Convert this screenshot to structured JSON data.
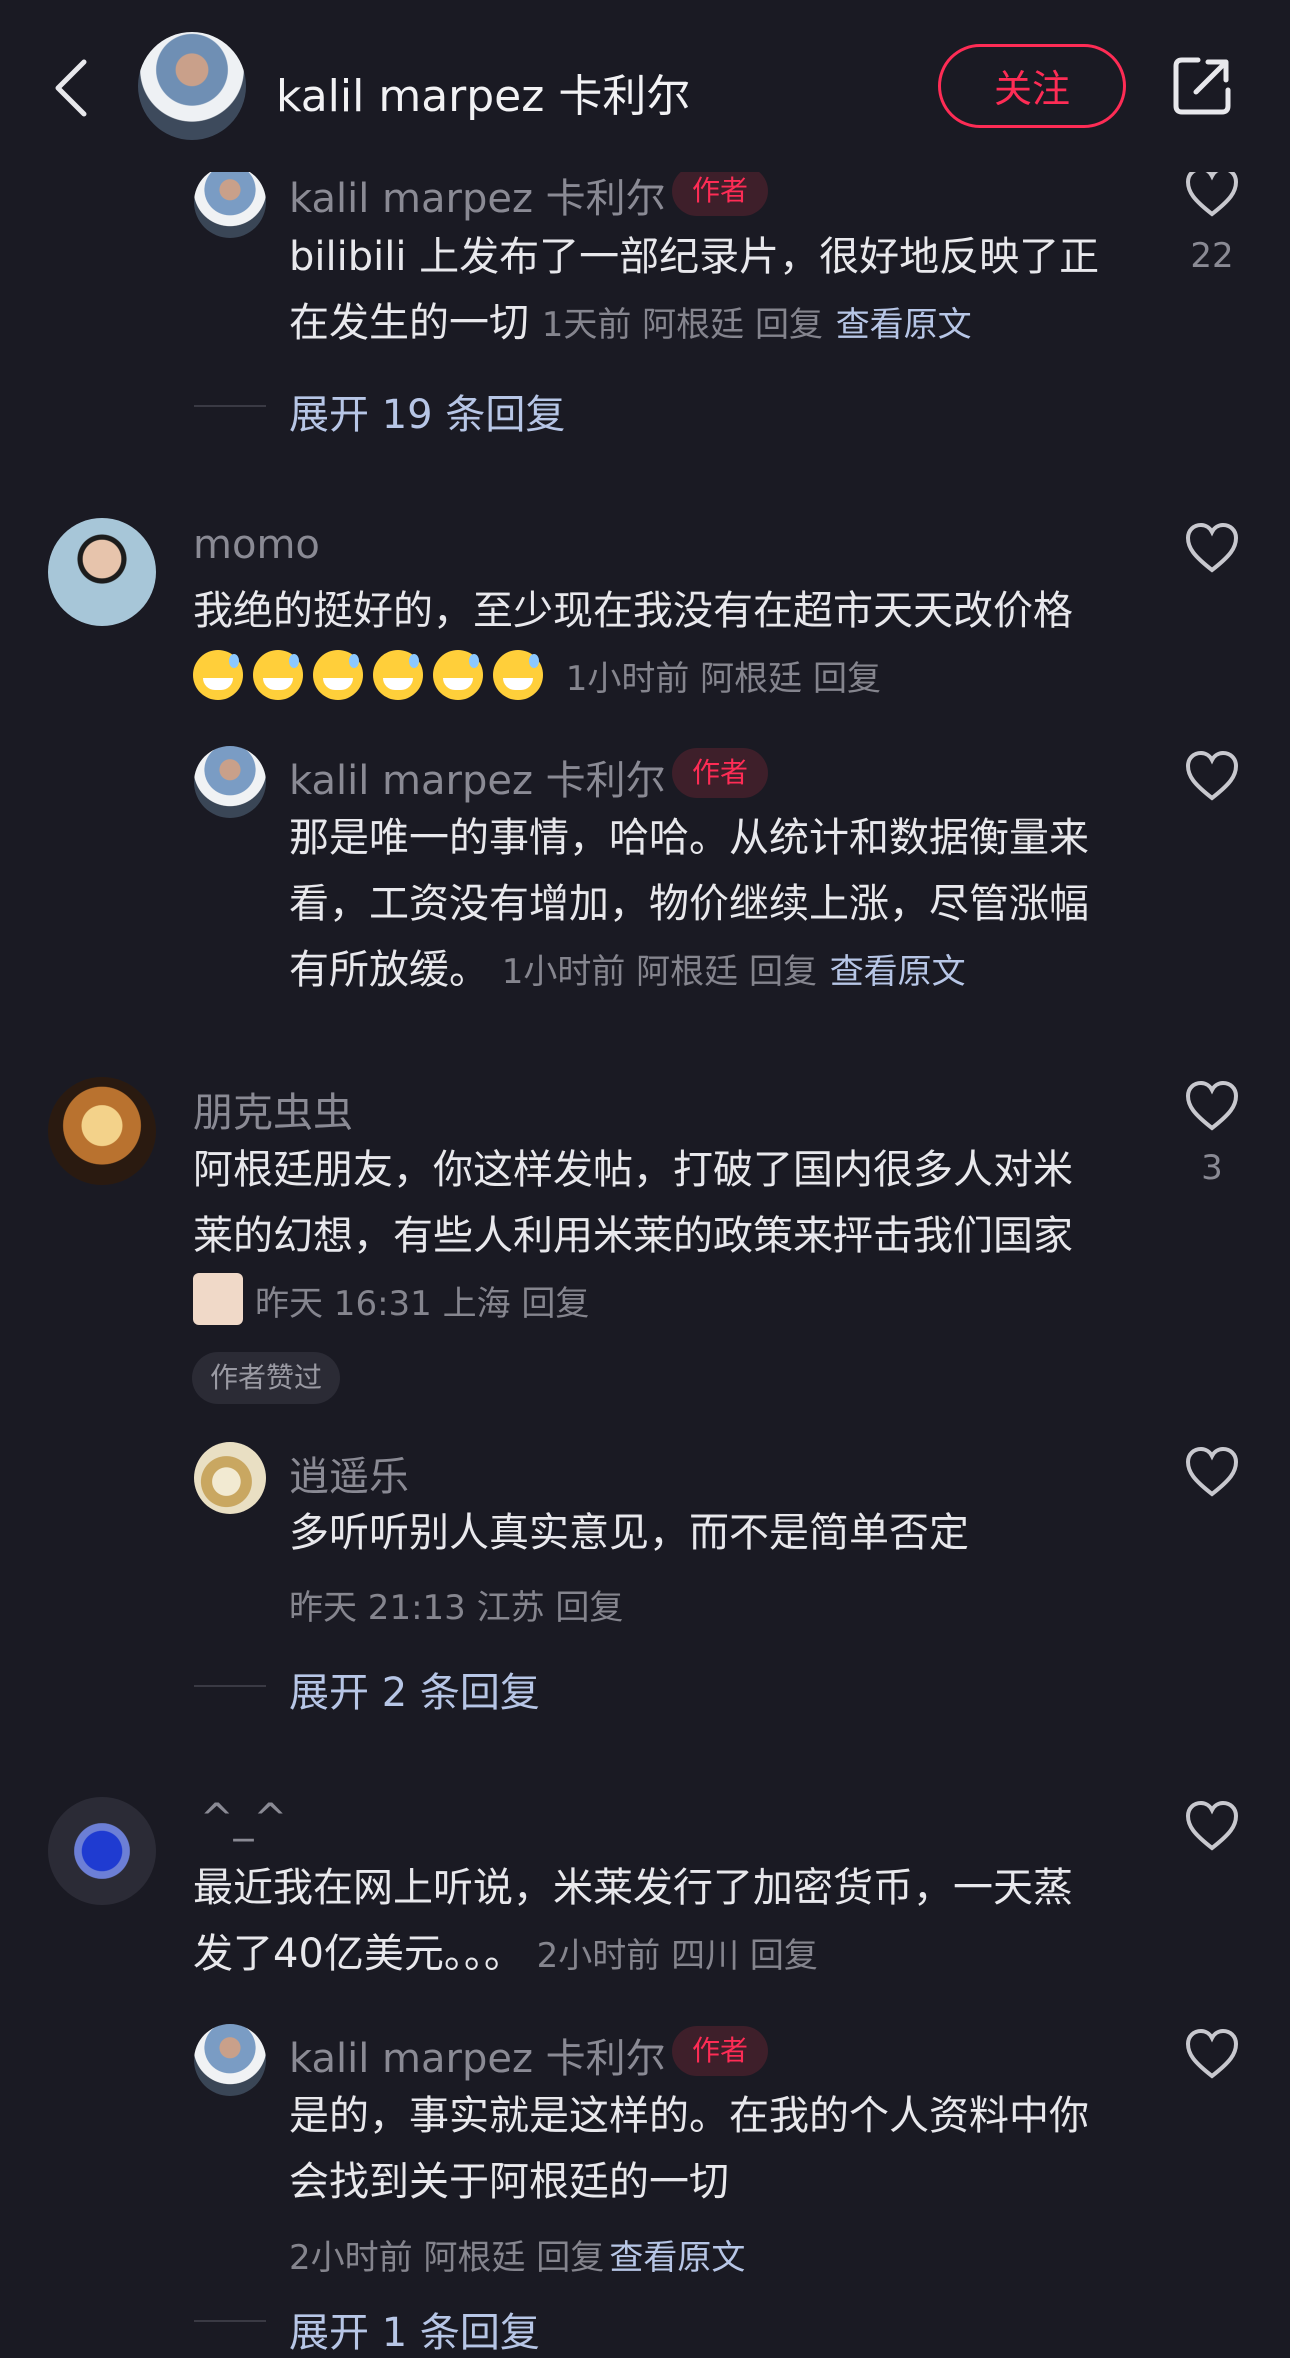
{
  "header": {
    "name": "kalil marpez 卡利尔",
    "follow_label": "关注"
  },
  "author_badge": "作者",
  "c0": {
    "user": "kalil marpez 卡利尔",
    "line1": "bilibili 上发布了一部纪录片，很好地反映了正",
    "line2": "在发生的一切",
    "meta": "1天前 阿根廷 回复",
    "link": "查看原文",
    "likes": "22",
    "expand": "展开 19 条回复"
  },
  "c1": {
    "user": "momo",
    "line1": "我绝的挺好的，至少现在我没有在超市天天改价格",
    "emoji": "😅😅😅😅😅😅",
    "meta": "1小时前 阿根廷 回复",
    "reply": {
      "user": "kalil marpez 卡利尔",
      "line1": "那是唯一的事情，哈哈。从统计和数据衡量来",
      "line2": "看，工资没有增加，物价继续上涨，尽管涨幅",
      "line3": "有所放缓。",
      "meta": "1小时前 阿根廷 回复",
      "link": "查看原文"
    }
  },
  "c2": {
    "user": "朋克虫虫",
    "line1": "阿根廷朋友，你这样发帖，打破了国内很多人对米",
    "line2": "莱的幻想，有些人利用米莱的政策来抨击我们国家",
    "meta": "昨天 16:31 上海 回复",
    "likes": "3",
    "liked_label": "作者赞过",
    "reply": {
      "user": "逍遥乐",
      "line1": "多听听别人真实意见，而不是简单否定",
      "meta": "昨天 21:13 江苏 回复"
    },
    "expand": "展开 2 条回复"
  },
  "c3": {
    "user": "^_^",
    "line1": "最近我在网上听说，米莱发行了加密货币，一天蒸",
    "line2": "发了40亿美元。。。",
    "meta": "2小时前 四川 回复",
    "reply": {
      "user": "kalil marpez 卡利尔",
      "line1": "是的，事实就是这样的。在我的个人资料中你",
      "line2": "会找到关于阿根廷的一切",
      "meta": "2小时前 阿根廷 回复",
      "link": "查看原文"
    },
    "expand": "展开 1 条回复"
  },
  "colors": {
    "accent": "#fe2c55",
    "background": "#1a1a23",
    "link": "#b7c6e6"
  },
  "icons": {
    "back": "chevron-left-icon",
    "share": "share-icon",
    "like": "heart-icon"
  }
}
